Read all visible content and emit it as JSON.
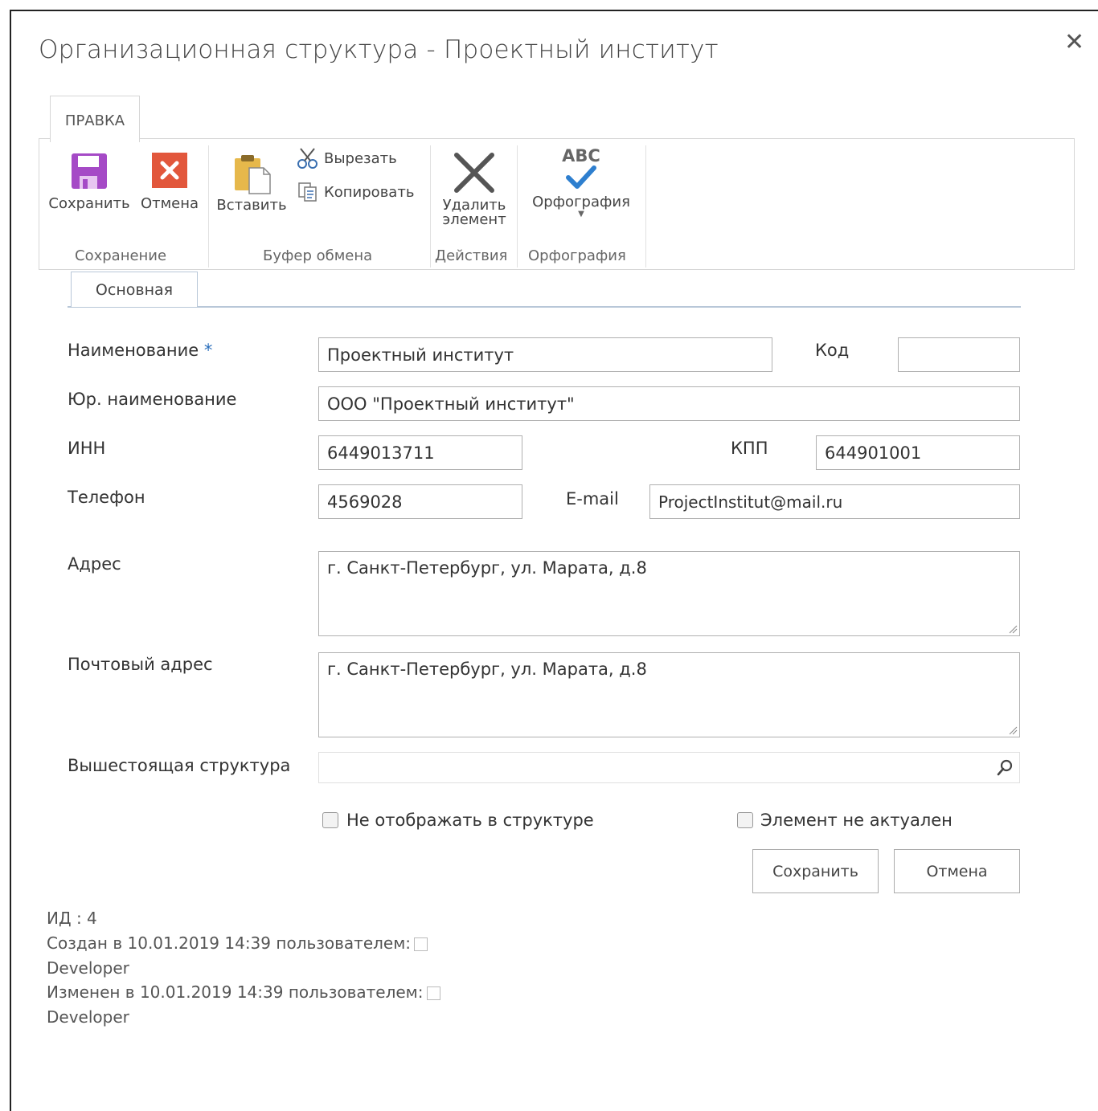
{
  "dialog": {
    "title": "Организационная структура - Проектный институт"
  },
  "ribbon": {
    "tab_label": "ПРАВКА",
    "save_label": "Сохранить",
    "cancel_label": "Отмена",
    "paste_label": "Вставить",
    "cut_label": "Вырезать",
    "copy_label": "Копировать",
    "delete_label_1": "Удалить",
    "delete_label_2": "элемент",
    "spelling_label": "Орфография",
    "spelling_icon_text": "ABC",
    "groups": {
      "save": "Сохранение",
      "clipboard": "Буфер обмена",
      "actions": "Действия",
      "spelling": "Орфография"
    }
  },
  "tabs": {
    "main": "Основная"
  },
  "form": {
    "name_label": "Наименование",
    "name_required": "*",
    "name_value": "Проектный институт",
    "code_label": "Код",
    "code_value": "",
    "legal_name_label": "Юр. наименование",
    "legal_name_value": "ООО \"Проектный институт\"",
    "inn_label": "ИНН",
    "inn_value": "6449013711",
    "kpp_label": "КПП",
    "kpp_value": "644901001",
    "phone_label": "Телефон",
    "phone_value": "4569028",
    "email_label": "E-mail",
    "email_value": "ProjectInstitut@mail.ru",
    "address_label": "Адрес",
    "address_value": "г. Санкт-Петербург, ул. Марата, д.8",
    "postal_label": "Почтовый адрес",
    "postal_value": "г. Санкт-Петербург, ул. Марата, д.8",
    "parent_label": "Вышестоящая структура",
    "parent_value": "",
    "hide_checkbox_label": "Не отображать в структуре",
    "inactive_checkbox_label": "Элемент не актуален",
    "save_button": "Сохранить",
    "cancel_button": "Отмена"
  },
  "meta": {
    "id_line": "ИД : 4",
    "created_prefix": "Создан в",
    "created_datetime": "10.01.2019 14:39",
    "created_by_label": "пользователем:",
    "created_user": "Developer",
    "modified_prefix": "Изменен в",
    "modified_datetime": "10.01.2019 14:39",
    "modified_by_label": "пользователем:",
    "modified_user": "Developer"
  },
  "colors": {
    "save_icon": "#a54ac6",
    "cancel_icon": "#e2573c",
    "check_icon": "#2e7fcf",
    "tab_border": "#b8c7d8"
  }
}
